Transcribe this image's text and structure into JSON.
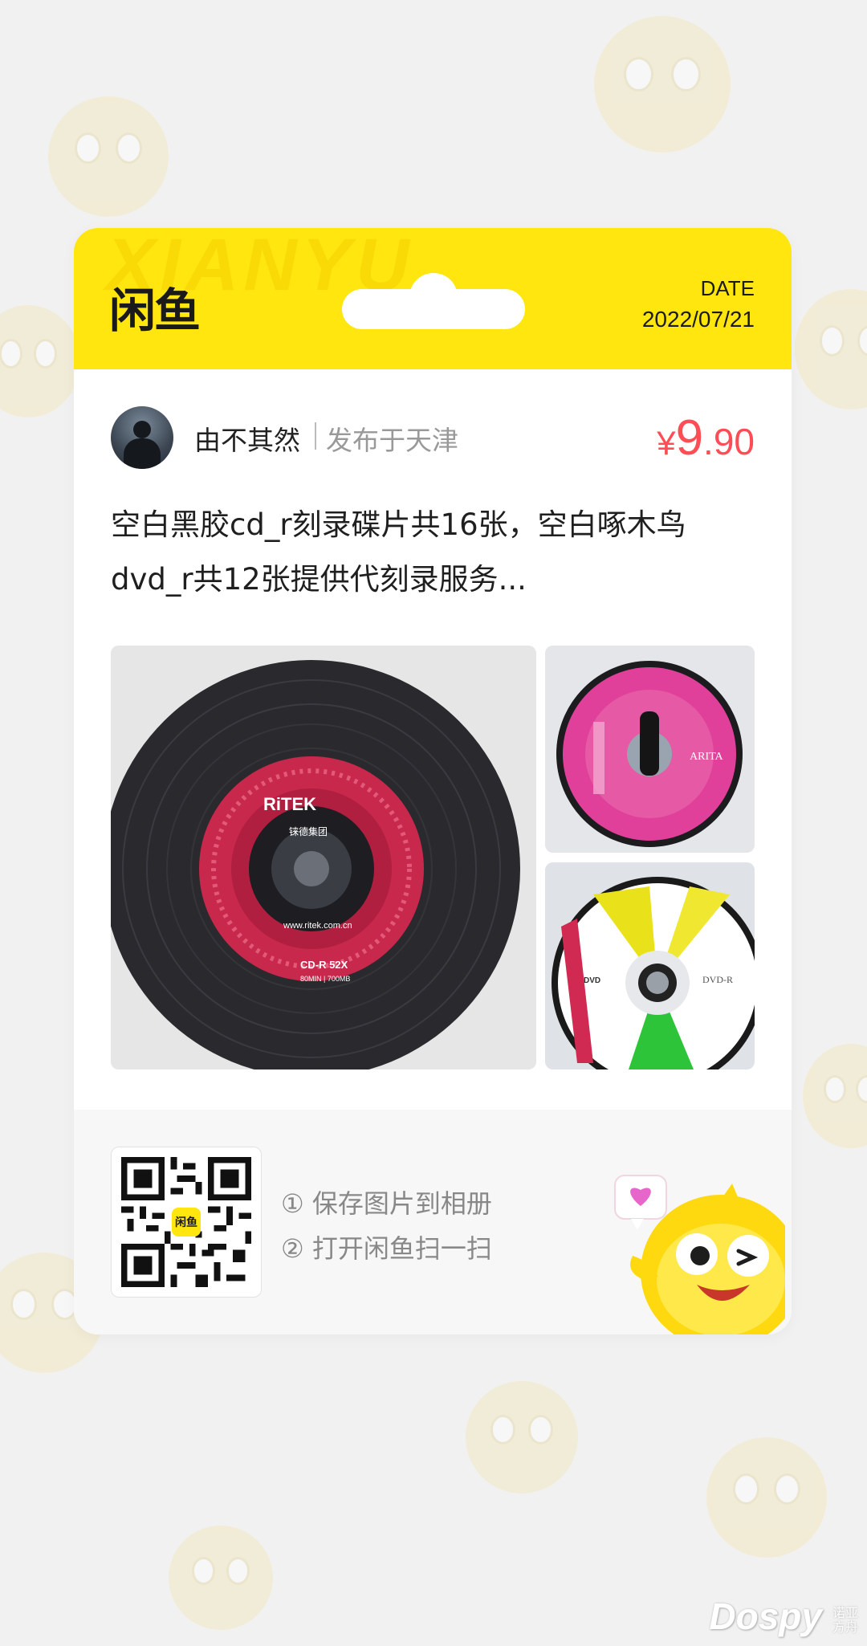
{
  "header": {
    "watermark": "XIANYU",
    "logo": "闲鱼",
    "date_label": "DATE",
    "date_value": "2022/07/21"
  },
  "seller": {
    "name": "由不其然",
    "location": "发布于天津"
  },
  "price": {
    "symbol": "¥",
    "integer": "9",
    "decimal": ".90"
  },
  "description": "空白黑胶cd_r刻录碟片共16张，空白啄木鸟dvd_r共12张提供代刻录服务...",
  "photos": {
    "main": {
      "brand": "RiTEK",
      "cn_text": "铼德集团",
      "url_text": "www.ritek.com.cn",
      "type": "CD-R  52X",
      "capacity": "80MIN | 700MB"
    },
    "side1": {
      "brand": "ARITA"
    },
    "side2": {
      "type": "DVD-R",
      "logo": "DVD"
    }
  },
  "footer": {
    "qr_logo": "闲鱼",
    "step1": "① 保存图片到相册",
    "step2": "② 打开闲鱼扫一扫"
  },
  "watermark": {
    "brand": "Dospy",
    "sub": "诺亚方舟"
  },
  "colors": {
    "brand_yellow": "#ffe60f",
    "price_red": "#ff4d55"
  }
}
